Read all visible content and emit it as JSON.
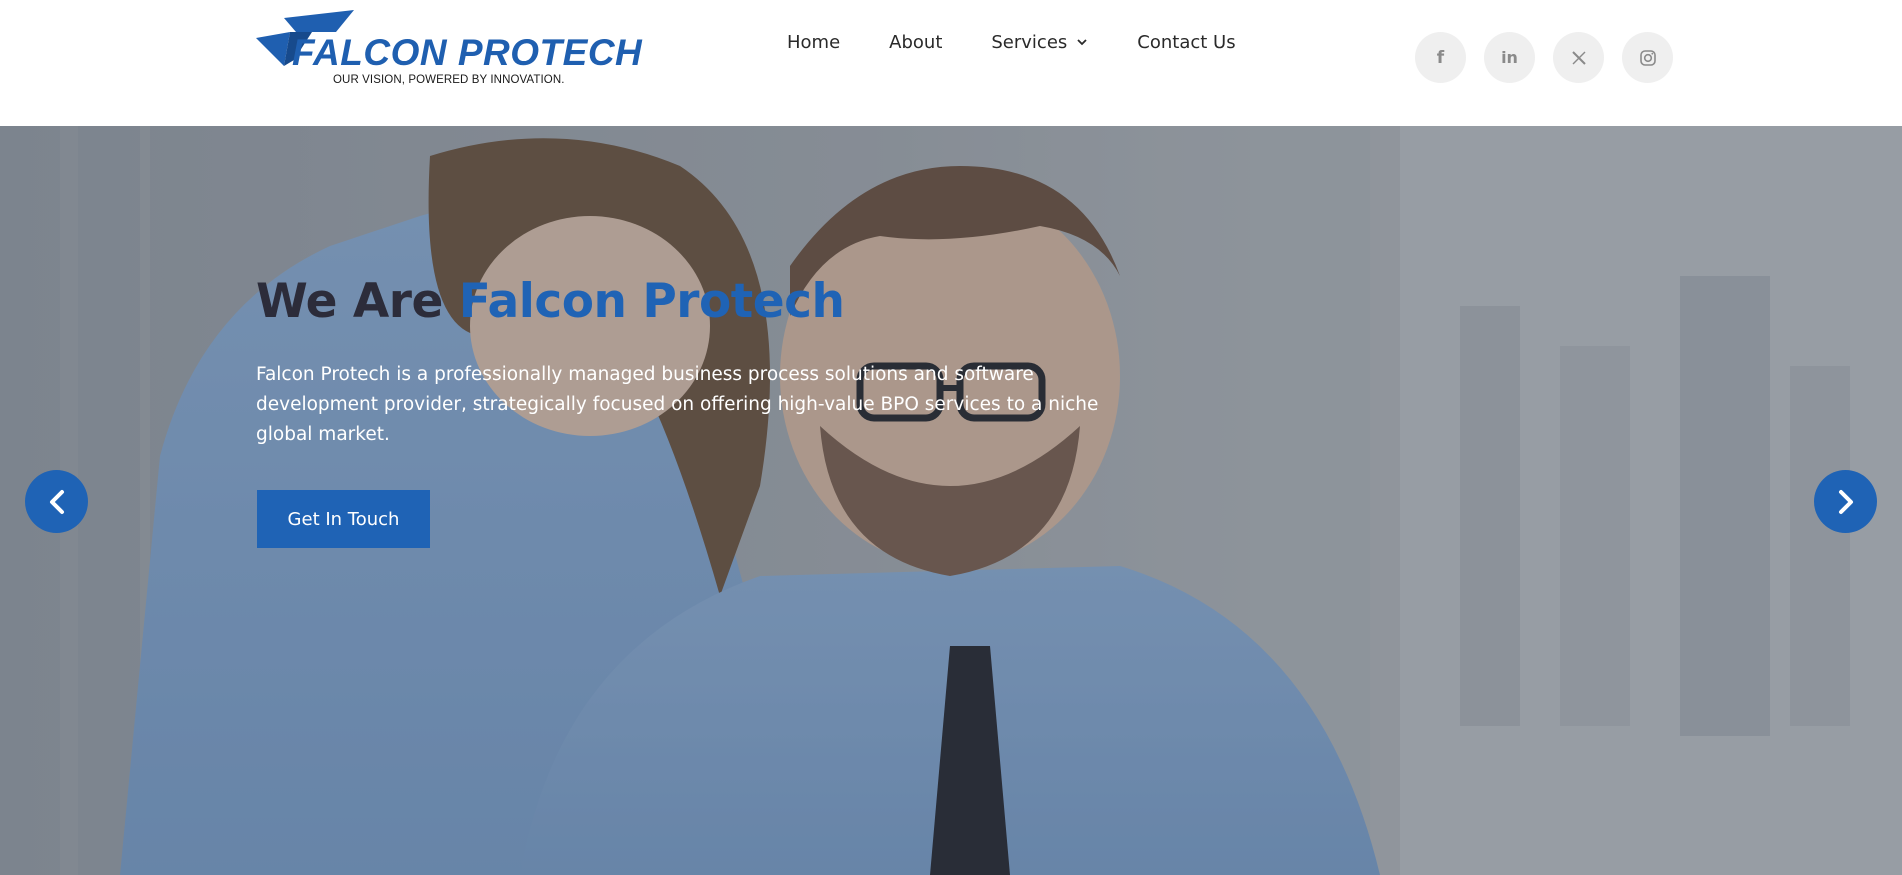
{
  "brand": {
    "name": "FALCON PROTECH",
    "tagline": "OUR VISION, POWERED BY INNOVATION.",
    "color": "#1f5fb0"
  },
  "nav": {
    "home": "Home",
    "about": "About",
    "services": "Services",
    "contact": "Contact Us"
  },
  "social": [
    {
      "icon": "facebook-icon",
      "glyph": "f"
    },
    {
      "icon": "linkedin-icon",
      "glyph": "in"
    },
    {
      "icon": "x-twitter-icon",
      "glyph": "X"
    },
    {
      "icon": "instagram-icon",
      "glyph": ""
    }
  ],
  "hero": {
    "title_part1": "We Are ",
    "title_part2": "Falcon Protech",
    "description": "Falcon Protech is a professionally managed business process solutions and software development provider, strategically focused on offering high-value BPO services to a niche global market.",
    "cta_label": "Get In Touch",
    "accent": "#1f63b5"
  }
}
